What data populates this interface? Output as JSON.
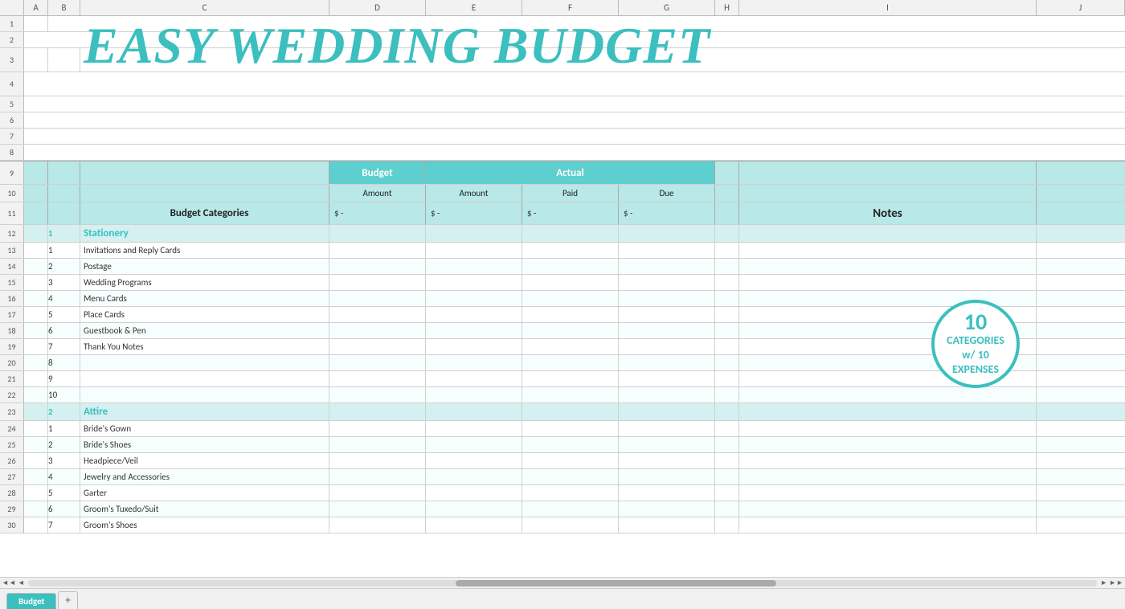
{
  "app": {
    "title": "Easy Wedding Budget",
    "title_display": "EASY WEDDING BUDGET"
  },
  "columns": {
    "letters": [
      "A",
      "B",
      "C",
      "D",
      "E",
      "F",
      "G",
      "H",
      "I",
      "J"
    ]
  },
  "header": {
    "budget_label": "Budget",
    "actual_label": "Actual",
    "amount_label": "Amount",
    "paid_label": "Paid",
    "due_label": "Due",
    "budget_categories_label": "Budget Categories",
    "notes_label": "Notes",
    "dollar_dash": "$ -"
  },
  "categories": [
    {
      "num": "1",
      "name": "Stationery",
      "items": [
        {
          "num": "1",
          "name": "Invitations and Reply Cards"
        },
        {
          "num": "2",
          "name": "Postage"
        },
        {
          "num": "3",
          "name": "Wedding Programs"
        },
        {
          "num": "4",
          "name": "Menu Cards"
        },
        {
          "num": "5",
          "name": "Place Cards"
        },
        {
          "num": "6",
          "name": "Guestbook & Pen"
        },
        {
          "num": "7",
          "name": "Thank You Notes"
        },
        {
          "num": "8",
          "name": ""
        },
        {
          "num": "9",
          "name": ""
        },
        {
          "num": "10",
          "name": ""
        }
      ]
    },
    {
      "num": "2",
      "name": "Attire",
      "items": [
        {
          "num": "1",
          "name": "Bride's Gown"
        },
        {
          "num": "2",
          "name": "Bride's Shoes"
        },
        {
          "num": "3",
          "name": "Headpiece/Veil"
        },
        {
          "num": "4",
          "name": "Jewelry and Accessories"
        },
        {
          "num": "5",
          "name": "Garter"
        },
        {
          "num": "6",
          "name": "Groom's Tuxedo/Suit"
        },
        {
          "num": "7",
          "name": "Groom's Shoes"
        }
      ]
    }
  ],
  "badge": {
    "number": "10",
    "line1": "CATEGORIES",
    "line2": "w/ 10",
    "line3": "EXPENSES"
  },
  "rows": {
    "row_nums": [
      "1",
      "2",
      "3",
      "4",
      "5",
      "6",
      "7",
      "8",
      "9",
      "10",
      "11",
      "12",
      "13",
      "14",
      "15",
      "16",
      "17",
      "18",
      "19",
      "20",
      "21",
      "22",
      "23",
      "24",
      "25",
      "26",
      "27",
      "28",
      "29",
      "30"
    ]
  },
  "tabs": {
    "active": "Budget",
    "add_icon": "+"
  },
  "colors": {
    "teal": "#3bbfbf",
    "teal_header": "#5ecfcf",
    "light_teal": "#b8e8e8",
    "light_teal2": "#d4f0f0"
  }
}
